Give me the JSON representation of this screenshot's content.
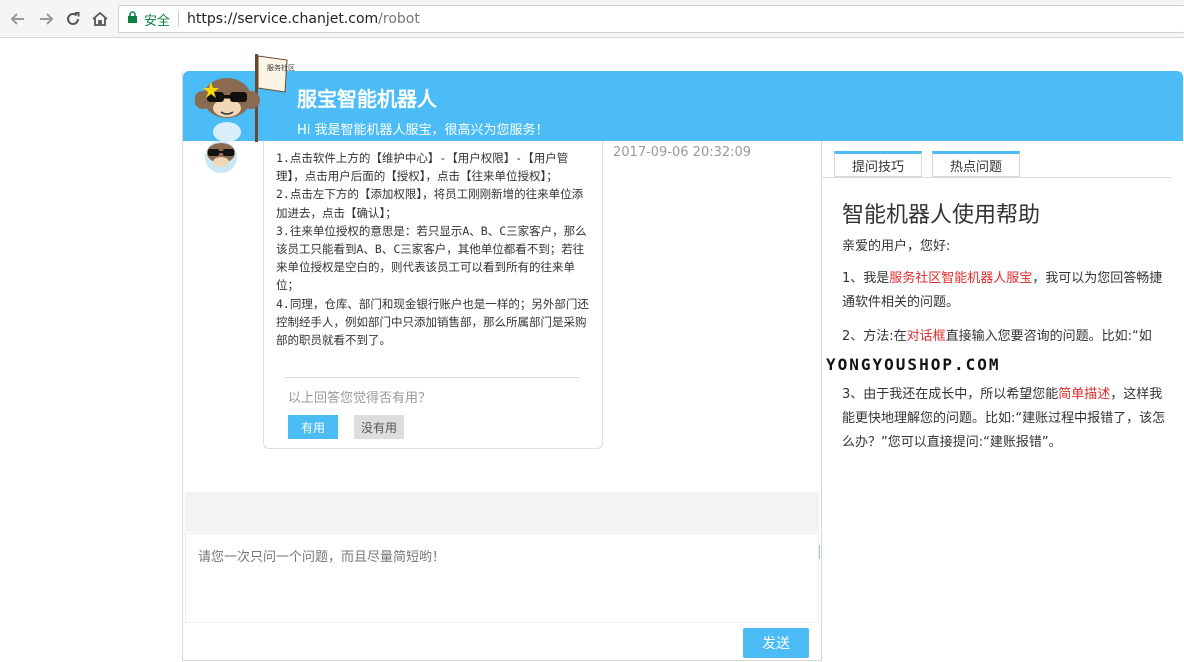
{
  "browser": {
    "secure_label": "安全",
    "url_host": "https://service.chanjet.com",
    "url_path": "/robot"
  },
  "header": {
    "title": "服宝智能机器人",
    "subtitle": "Hi 我是智能机器人服宝，很高兴为您服务！"
  },
  "mascot": {
    "flag_text": "服务社区"
  },
  "chat": {
    "timestamp": "2017-09-06 20:32:09",
    "answer_lines": [
      "1.点击软件上方的【维护中心】-【用户权限】-【用户管理】，点击用户后面的【授权】，点击【往来单位授权】；",
      "2.点击左下方的【添加权限】，将员工刚刚新增的往来单位添加进去，点击【确认】；",
      "3.往来单位授权的意思是：若只显示A、B、C三家客户，那么该员工只能看到A、B、C三家客户，其他单位都看不到；若往来单位授权是空白的，则代表该员工可以看到所有的往来单位；",
      "4.同理，仓库、部门和现金银行账户也是一样的；另外部门还控制经手人，例如部门中只添加销售部，那么所属部门是采购部的职员就看不到了。"
    ],
    "feedback_question": "以上回答您觉得否有用？",
    "yes_label": "有用",
    "no_label": "没有用",
    "input_placeholder": "请您一次只问一个问题，而且尽量简短哟！",
    "send_label": "发送"
  },
  "help": {
    "tabs": [
      "提问技巧",
      "热点问题"
    ],
    "title": "智能机器人使用帮助",
    "greeting": "亲爱的用户，您好:",
    "p1_a": "1、我是",
    "p1_red": "服务社区智能机器人服宝",
    "p1_b": "，我可以为您回答畅捷通软件相关的问题。",
    "p2_a": "2、方法:在",
    "p2_red": "对话框",
    "p2_b": "直接输入您要咨询的问题。比如:“如",
    "p3_a": "3、由于我还在成长中，所以希望您能",
    "p3_red": "简单描述",
    "p3_b": "，这样我能更快地理解您的问题。比如:“建账过程中报错了，该怎么办？”您可以直接提问:“建账报错”。"
  },
  "watermark": "YONGYOUSHOP.COM",
  "colors": {
    "accent": "#4bbcf5",
    "red": "#e02b2b",
    "secure": "#0b8043"
  }
}
